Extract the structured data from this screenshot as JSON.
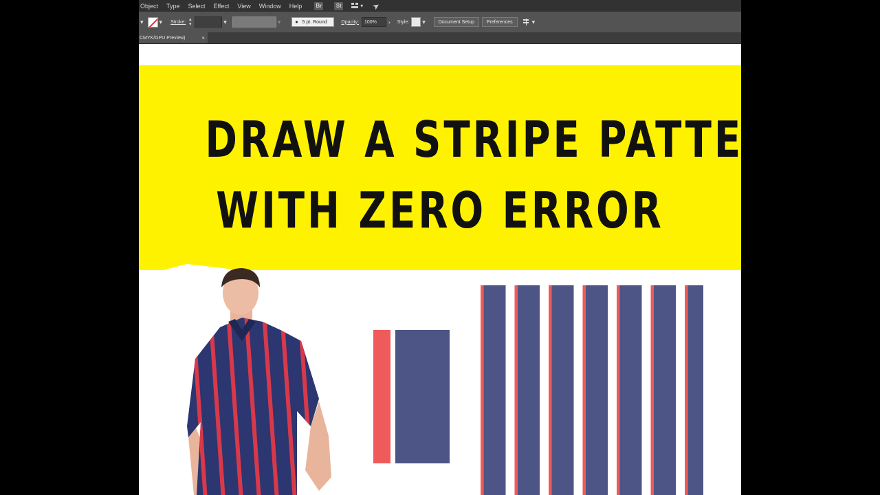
{
  "menubar": {
    "items": [
      "Object",
      "Type",
      "Select",
      "Effect",
      "View",
      "Window",
      "Help"
    ],
    "bridge_badge": "Br",
    "stock_badge": "St"
  },
  "controlbar": {
    "stroke_label": "Stroke:",
    "brush_label": "5 pt. Round",
    "opacity_label": "Opacity:",
    "opacity_value": "100%",
    "style_label": "Style:",
    "document_setup_label": "Document Setup",
    "preferences_label": "Preferences"
  },
  "tab": {
    "label": "CMYK/GPU Preview)",
    "close": "×"
  },
  "banner": {
    "line1": "DRAW A STRIPE PATTERN",
    "line2": "WITH ZERO ERROR"
  },
  "colors": {
    "banner_yellow": "#fff200",
    "stripe_red": "#ef5a5a",
    "stripe_blue": "#4c5585",
    "ui_dark": "#323232",
    "ui_panel": "#535353"
  },
  "icons": {
    "menu": [
      "bridge-icon",
      "stock-icon",
      "workspace-icon",
      "rocket-icon"
    ],
    "control": [
      "fill-swatch-icon",
      "stroke-stepper-icon",
      "arrow-right-icon",
      "align-icon",
      "close-icon"
    ]
  }
}
